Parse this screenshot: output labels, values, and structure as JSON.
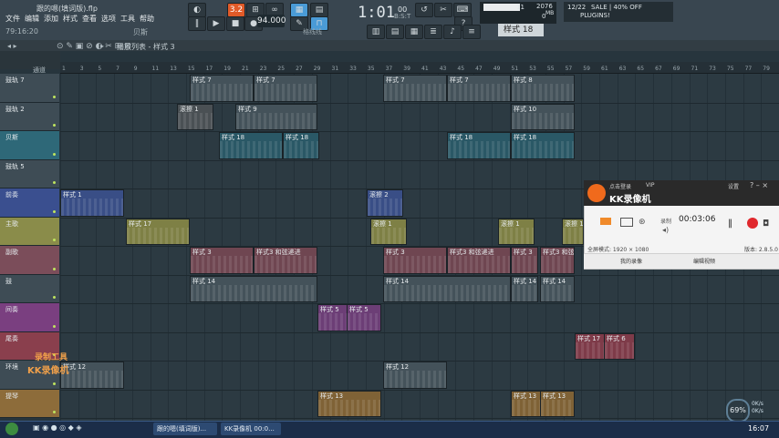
{
  "window": {
    "title": "跟的嗯(填词版).flp",
    "time_small": "79:16:20"
  },
  "menu": [
    "文件",
    "编辑",
    "添加",
    "样式",
    "查看",
    "选项",
    "工具",
    "帮助"
  ],
  "top_misc": {
    "label_left": "贝斯"
  },
  "transport": {
    "mode": "3.2",
    "tempo": "94.000",
    "song_time": "1:01",
    "song_time_ms": "00",
    "song_time_sub": "B:S:T"
  },
  "cpu": {
    "memory": "11",
    "mem_unit": "MB",
    "usage_text": "2076",
    "voices": "0"
  },
  "news": {
    "date": "12/22",
    "headline": "SALE | 40% OFF",
    "headline2": "PLUGINS!"
  },
  "pattern": {
    "selected": "样式 18"
  },
  "snap": {
    "label": "格线线"
  },
  "playlist": {
    "title": "播放列表 - 样式 3",
    "breadcrumb": "通道"
  },
  "ruler": [
    "1",
    "3",
    "5",
    "7",
    "9",
    "11",
    "13",
    "15",
    "17",
    "19",
    "21",
    "23",
    "25",
    "27",
    "29",
    "31",
    "33",
    "35",
    "37",
    "39",
    "41",
    "43",
    "45",
    "47",
    "49",
    "51",
    "53",
    "55",
    "57",
    "59",
    "61",
    "63",
    "65",
    "67",
    "69",
    "71",
    "73",
    "75",
    "77",
    "79"
  ],
  "tracks": [
    {
      "name": "鼓轨 7",
      "color": "#3e4c55"
    },
    {
      "name": "鼓轨 2",
      "color": "#3e4c55"
    },
    {
      "name": "贝斯",
      "color": "#2e6878"
    },
    {
      "name": "鼓轨 5",
      "color": "#3e4c55"
    },
    {
      "name": "前奏",
      "color": "#3a4f8f"
    },
    {
      "name": "主歌",
      "color": "#8a8c4a"
    },
    {
      "name": "副歌",
      "color": "#7b4d5a"
    },
    {
      "name": "鼓",
      "color": "#3e4c55"
    },
    {
      "name": "间奏",
      "color": "#7a3f80"
    },
    {
      "name": "尾奏",
      "color": "#8a3f4d"
    },
    {
      "name": "环境",
      "color": "#3e4c55"
    },
    {
      "name": "提琴",
      "color": "#8d6c3a"
    }
  ],
  "clips": [
    {
      "label": "样式 7",
      "row": 0,
      "c": "#44525a"
    },
    {
      "label": "样式 7",
      "row": 0,
      "c": "#44525a"
    },
    {
      "label": "样式 7",
      "row": 0,
      "c": "#44525a"
    },
    {
      "label": "样式 7",
      "row": 0,
      "c": "#44525a"
    },
    {
      "label": "样式 8",
      "row": 0,
      "c": "#44525a"
    },
    {
      "label": "滚擦 1",
      "row": 1,
      "c": "#4a5054"
    },
    {
      "label": "样式 9",
      "row": 1,
      "c": "#44525a"
    },
    {
      "label": "样式 10",
      "row": 1,
      "c": "#44525a"
    },
    {
      "label": "样式 18",
      "row": 2,
      "c": "#2a5866"
    },
    {
      "label": "样式 18",
      "row": 2,
      "c": "#2a5866"
    },
    {
      "label": "样式 18",
      "row": 2,
      "c": "#2a5866"
    },
    {
      "label": "样式 18",
      "row": 2,
      "c": "#2a5866"
    },
    {
      "label": "样式 1",
      "row": 4,
      "c": "#394e86"
    },
    {
      "label": "滚擦 2",
      "row": 4,
      "c": "#394e86"
    },
    {
      "label": "样式 17",
      "row": 5,
      "c": "#7e8045"
    },
    {
      "label": "滚擦 1",
      "row": 5,
      "c": "#7e8045"
    },
    {
      "label": "滚擦 1",
      "row": 5,
      "c": "#7e8045"
    },
    {
      "label": "滚擦 1",
      "row": 5,
      "c": "#7e8045"
    },
    {
      "label": "样式 3",
      "row": 6,
      "c": "#6f4651"
    },
    {
      "label": "样式3 和弦递进",
      "row": 6,
      "c": "#6f4651"
    },
    {
      "label": "样式 3",
      "row": 6,
      "c": "#6f4651"
    },
    {
      "label": "样式3 和弦递进",
      "row": 6,
      "c": "#6f4651"
    },
    {
      "label": "样式 3",
      "row": 6,
      "c": "#6f4651"
    },
    {
      "label": "样式3 和弦递进",
      "row": 6,
      "c": "#6f4651"
    },
    {
      "label": "样式 14",
      "row": 7,
      "c": "#44525a"
    },
    {
      "label": "样式 14",
      "row": 7,
      "c": "#44525a"
    },
    {
      "label": "样式 14",
      "row": 7,
      "c": "#44525a"
    },
    {
      "label": "样式 14",
      "row": 7,
      "c": "#44525a"
    },
    {
      "label": "样式 5",
      "row": 8,
      "c": "#6c3e76"
    },
    {
      "label": "样式 5",
      "row": 8,
      "c": "#6c3e76"
    },
    {
      "label": "样式 17",
      "row": 9,
      "c": "#7e3b49"
    },
    {
      "label": "样式 6",
      "row": 9,
      "c": "#7e3b49"
    },
    {
      "label": "样式 12",
      "row": 10,
      "c": "#44525a"
    },
    {
      "label": "样式 12",
      "row": 10,
      "c": "#44525a"
    },
    {
      "label": "样式 13",
      "row": 11,
      "c": "#7f6236"
    },
    {
      "label": "样式 13",
      "row": 11,
      "c": "#7f6236"
    },
    {
      "label": "样式 13",
      "row": 11,
      "c": "#7f6236"
    }
  ],
  "recorder": {
    "app_small": "点击登录",
    "vip": "VIP",
    "settings": "设置",
    "name": "KK录像机",
    "rec_label": "录制",
    "elapsed": "00:03:06",
    "mode": "全屏模式: 1920 × 1080",
    "version": "版本: 2.8.5.0",
    "tab_recordings": "我的录像",
    "tab_edit": "编辑视频"
  },
  "watermark": {
    "line1": "录制工具",
    "line2": "KK录像机"
  },
  "taskbar": {
    "apps": [
      "跟的嗯(填词版)...",
      "KK录像机 00:0..."
    ],
    "time": "16:07",
    "cpu_pct": "69%",
    "net_up": "0K/s",
    "net_down": "0K/s"
  }
}
